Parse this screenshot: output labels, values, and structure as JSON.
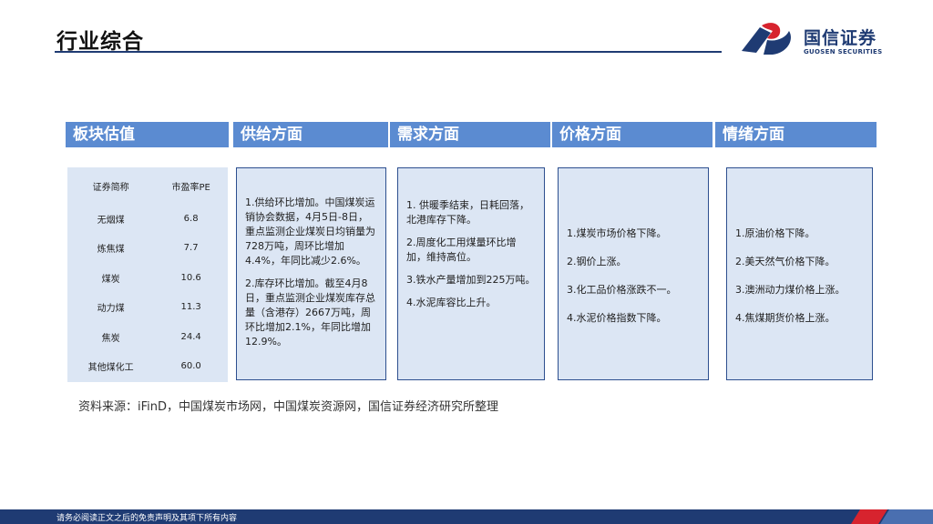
{
  "title": "行业综合",
  "logo": {
    "cn": "国信证券",
    "en": "GUOSEN SECURITIES"
  },
  "headers": [
    "板块估值",
    "供给方面",
    "需求方面",
    "价格方面",
    "情绪方面"
  ],
  "valuation": {
    "columns": [
      "证券简称",
      "市盈率PE"
    ],
    "rows": [
      [
        "无烟煤",
        "6.8"
      ],
      [
        "炼焦煤",
        "7.7"
      ],
      [
        "煤炭",
        "10.6"
      ],
      [
        "动力煤",
        "11.3"
      ],
      [
        "焦炭",
        "24.4"
      ],
      [
        "其他煤化工",
        "60.0"
      ]
    ]
  },
  "supply": [
    "1.供给环比增加。中国煤炭运销协会数据，4月5日-8日，重点监测企业煤炭日均销量为728万吨，周环比增加4.4%，年同比减少2.6%。",
    "2.库存环比增加。截至4月8日，重点监测企业煤炭库存总量（含港存）2667万吨，周环比增加2.1%，年同比增加12.9%。"
  ],
  "demand": [
    "1. 供暖季结束，日耗回落，北港库存下降。",
    "2.周度化工用煤量环比增加，维持高位。",
    "3.铁水产量增加到225万吨。",
    "4.水泥库容比上升。"
  ],
  "price": [
    "1.煤炭市场价格下降。",
    "2.钢价上涨。",
    "3.化工品价格涨跌不一。",
    "4.水泥价格指数下降。"
  ],
  "sentiment": [
    "1.原油价格下降。",
    "2.美天然气价格下降。",
    "3.澳洲动力煤价格上涨。",
    "4.焦煤期货价格上涨。"
  ],
  "source": "资料来源：iFinD，中国煤炭市场网，中国煤炭资源网，国信证券经济研究所整理",
  "footer": "请务必阅读正文之后的免责声明及其项下所有内容",
  "colors": {
    "header": "#5b8bd1",
    "box": "#dce6f4",
    "brand": "#1f3b73",
    "logo_red": "#d7232e"
  }
}
